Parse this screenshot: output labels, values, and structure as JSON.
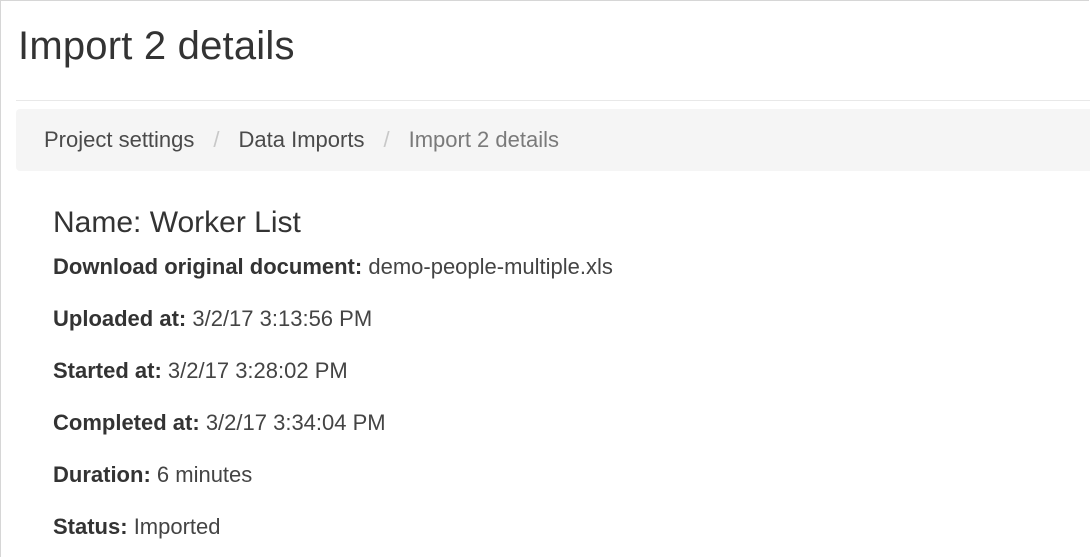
{
  "page": {
    "title": "Import 2 details"
  },
  "breadcrumb": {
    "items": [
      "Project settings",
      "Data Imports"
    ],
    "separator": "/",
    "current": "Import 2 details"
  },
  "import": {
    "name_label": "Name:",
    "name_value": "Worker List",
    "download_label": "Download original document:",
    "download_file": "demo-people-multiple.xls",
    "uploaded_label": "Uploaded at:",
    "uploaded_value": "3/2/17 3:13:56 PM",
    "started_label": "Started at:",
    "started_value": "3/2/17 3:28:02 PM",
    "completed_label": "Completed at:",
    "completed_value": "3/2/17 3:34:04 PM",
    "duration_label": "Duration:",
    "duration_value": "6 minutes",
    "status_label": "Status:",
    "status_value": "Imported"
  }
}
